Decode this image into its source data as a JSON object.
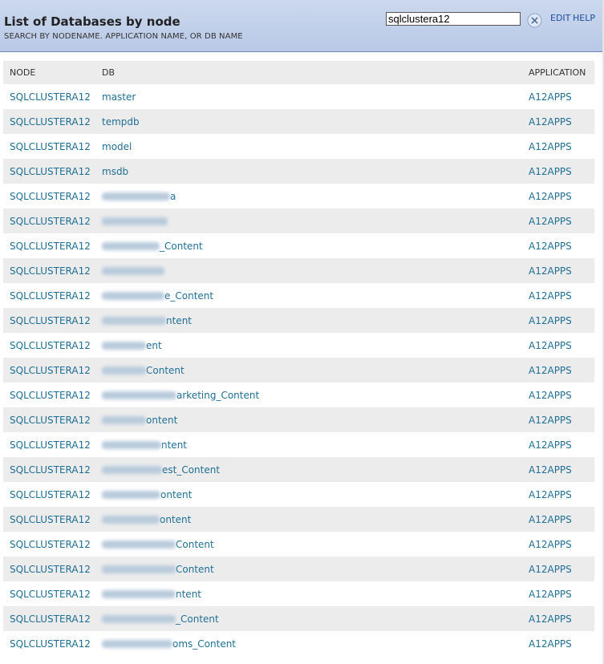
{
  "header": {
    "title": "List of Databases by node",
    "subtitle": "SEARCH BY NODENAME. APPLICATION NAME, OR DB NAME",
    "search_value": "sqlclustera12",
    "edit_label": "EDIT",
    "help_label": "HELP",
    "clear_icon": "close-circle-icon"
  },
  "table": {
    "columns": {
      "node": "NODE",
      "db": "DB",
      "application": "APPLICATION"
    },
    "rows": [
      {
        "node": "SQLCLUSTERA12",
        "db": "master",
        "application": "A12APPS",
        "redacted": false
      },
      {
        "node": "SQLCLUSTERA12",
        "db": "tempdb",
        "application": "A12APPS",
        "redacted": false
      },
      {
        "node": "SQLCLUSTERA12",
        "db": "model",
        "application": "A12APPS",
        "redacted": false
      },
      {
        "node": "SQLCLUSTERA12",
        "db": "msdb",
        "application": "A12APPS",
        "redacted": false
      },
      {
        "node": "SQLCLUSTERA12",
        "db": "a",
        "application": "A12APPS",
        "redacted": true
      },
      {
        "node": "SQLCLUSTERA12",
        "db": "",
        "application": "A12APPS",
        "redacted": true
      },
      {
        "node": "SQLCLUSTERA12",
        "db": "_Content",
        "application": "A12APPS",
        "redacted": true
      },
      {
        "node": "SQLCLUSTERA12",
        "db": "",
        "application": "A12APPS",
        "redacted": true
      },
      {
        "node": "SQLCLUSTERA12",
        "db": "e_Content",
        "application": "A12APPS",
        "redacted": true
      },
      {
        "node": "SQLCLUSTERA12",
        "db": "ntent",
        "application": "A12APPS",
        "redacted": true
      },
      {
        "node": "SQLCLUSTERA12",
        "db": "ent",
        "application": "A12APPS",
        "redacted": true
      },
      {
        "node": "SQLCLUSTERA12",
        "db": "Content",
        "application": "A12APPS",
        "redacted": true
      },
      {
        "node": "SQLCLUSTERA12",
        "db": "arketing_Content",
        "application": "A12APPS",
        "redacted": true
      },
      {
        "node": "SQLCLUSTERA12",
        "db": "ontent",
        "application": "A12APPS",
        "redacted": true
      },
      {
        "node": "SQLCLUSTERA12",
        "db": "ntent",
        "application": "A12APPS",
        "redacted": true
      },
      {
        "node": "SQLCLUSTERA12",
        "db": "est_Content",
        "application": "A12APPS",
        "redacted": true
      },
      {
        "node": "SQLCLUSTERA12",
        "db": "ontent",
        "application": "A12APPS",
        "redacted": true
      },
      {
        "node": "SQLCLUSTERA12",
        "db": "ontent",
        "application": "A12APPS",
        "redacted": true
      },
      {
        "node": "SQLCLUSTERA12",
        "db": "Content",
        "application": "A12APPS",
        "redacted": true
      },
      {
        "node": "SQLCLUSTERA12",
        "db": "Content",
        "application": "A12APPS",
        "redacted": true
      },
      {
        "node": "SQLCLUSTERA12",
        "db": "ntent",
        "application": "A12APPS",
        "redacted": true
      },
      {
        "node": "SQLCLUSTERA12",
        "db": "_Content",
        "application": "A12APPS",
        "redacted": true
      },
      {
        "node": "SQLCLUSTERA12",
        "db": "oms_Content",
        "application": "A12APPS",
        "redacted": true
      }
    ]
  },
  "colors": {
    "header_bg": "#c3d2eb",
    "link": "#1f6f95",
    "row_alt": "#ececec"
  }
}
